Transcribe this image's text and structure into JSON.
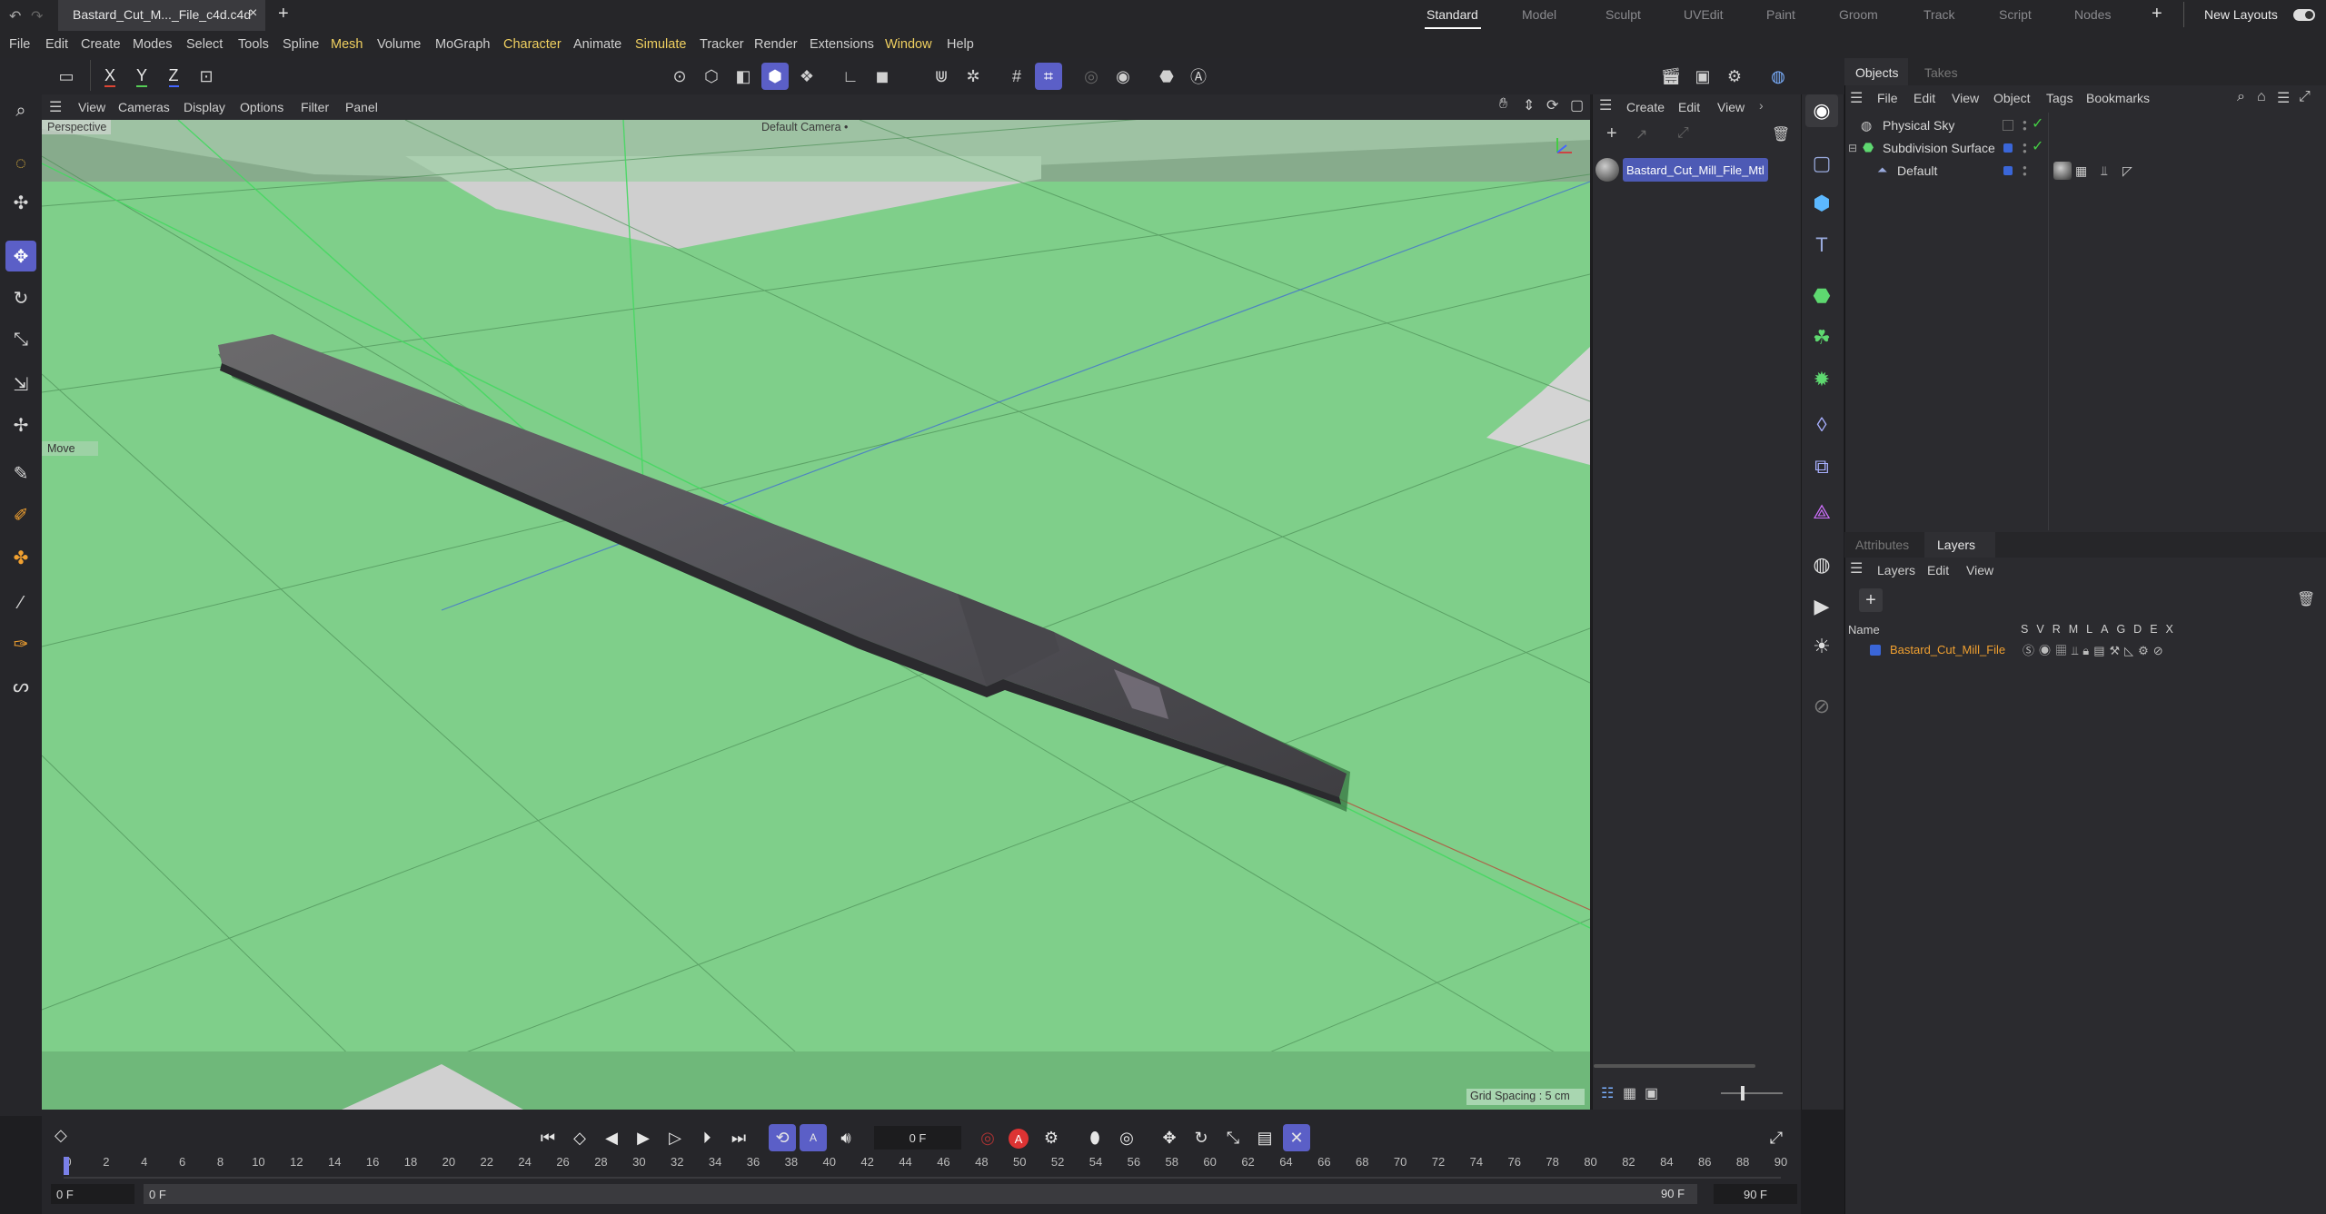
{
  "titlebar": {
    "file_tab": "Bastard_Cut_M..._File_c4d.c4d",
    "layouts": [
      "Standard",
      "Model",
      "Sculpt",
      "UVEdit",
      "Paint",
      "Groom",
      "Track",
      "Script",
      "Nodes"
    ],
    "active_layout": "Standard",
    "new_layouts": "New Layouts"
  },
  "menubar": {
    "items": [
      "File",
      "Edit",
      "Create",
      "Modes",
      "Select",
      "Tools",
      "Spline",
      "Mesh",
      "Volume",
      "MoGraph",
      "Character",
      "Animate",
      "Simulate",
      "Tracker",
      "Render",
      "Extensions",
      "Window",
      "Help"
    ],
    "highlighted": [
      "Mesh",
      "Character",
      "Simulate",
      "Window"
    ]
  },
  "toolbar": {
    "axes": [
      "X",
      "Y",
      "Z"
    ]
  },
  "viewport": {
    "menu": [
      "View",
      "Cameras",
      "Display",
      "Options",
      "Filter",
      "Panel"
    ],
    "projection": "Perspective",
    "camera": "Default Camera",
    "camera_suffix": "•",
    "tool_hint": "Move",
    "grid_spacing": "Grid Spacing : 5 cm",
    "background_color": "#7fcf8a"
  },
  "material_manager": {
    "menu": [
      "Create",
      "Edit",
      "View"
    ],
    "materials": [
      "Bastard_Cut_Mill_File_Mtl"
    ]
  },
  "objects_panel": {
    "tabs": [
      "Objects",
      "Takes"
    ],
    "active_tab": "Objects",
    "menu": [
      "File",
      "Edit",
      "View",
      "Object",
      "Tags",
      "Bookmarks"
    ],
    "objects": [
      {
        "name": "Physical Sky",
        "indent": 0
      },
      {
        "name": "Subdivision Surface",
        "indent": 0
      },
      {
        "name": "Default",
        "indent": 1
      }
    ]
  },
  "layers_panel": {
    "tabs": [
      "Attributes",
      "Layers"
    ],
    "active_tab": "Layers",
    "menu": [
      "Layers",
      "Edit",
      "View"
    ],
    "column_name": "Name",
    "column_flags": [
      "S",
      "V",
      "R",
      "M",
      "L",
      "A",
      "G",
      "D",
      "E",
      "X"
    ],
    "layers": [
      {
        "name": "Bastard_Cut_Mill_File",
        "color": "#3a66d8"
      }
    ]
  },
  "timeline": {
    "current_frame": "0 F",
    "start_field": "0 F",
    "start_field2": "0 F",
    "end_field": "90 F",
    "end_field2": "90 F",
    "ticks": [
      "0",
      "2",
      "4",
      "6",
      "8",
      "10",
      "12",
      "14",
      "16",
      "18",
      "20",
      "22",
      "24",
      "26",
      "28",
      "30",
      "32",
      "34",
      "36",
      "38",
      "40",
      "42",
      "44",
      "46",
      "48",
      "50",
      "52",
      "54",
      "56",
      "58",
      "60",
      "62",
      "64",
      "66",
      "68",
      "70",
      "72",
      "74",
      "76",
      "78",
      "80",
      "82",
      "84",
      "86",
      "88",
      "90"
    ]
  }
}
